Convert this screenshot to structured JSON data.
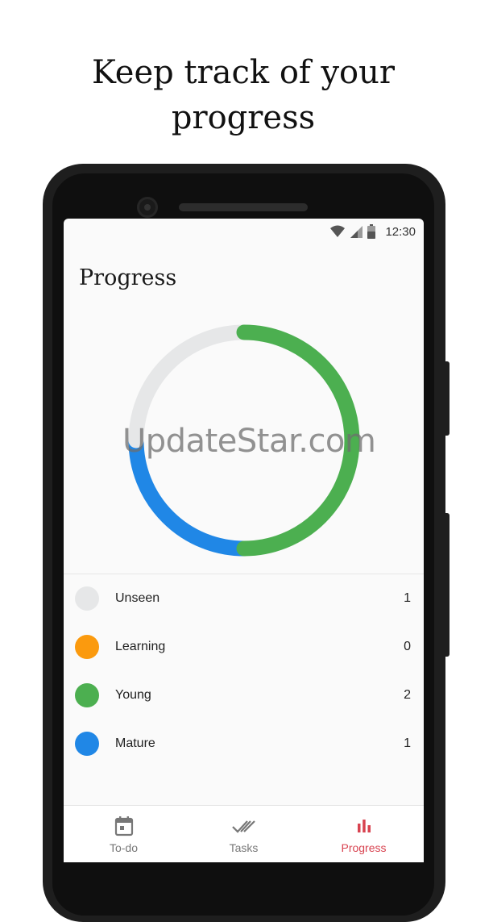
{
  "headline": {
    "line1": "Keep track of your",
    "line2": "progress"
  },
  "status_bar": {
    "time": "12:30",
    "icons": [
      "wifi-icon",
      "cell-signal-icon",
      "battery-icon"
    ]
  },
  "page": {
    "title": "Progress"
  },
  "donut": {
    "segments": [
      {
        "name": "Unseen",
        "value": 1,
        "color": "#e6e7e8"
      },
      {
        "name": "Learning",
        "value": 0,
        "color": "#fb9a0e"
      },
      {
        "name": "Young",
        "value": 2,
        "color": "#4caf50"
      },
      {
        "name": "Mature",
        "value": 1,
        "color": "#2087e6"
      }
    ]
  },
  "legend": [
    {
      "label": "Unseen",
      "count": "1",
      "color": "#e6e7e8"
    },
    {
      "label": "Learning",
      "count": "0",
      "color": "#fb9a0e"
    },
    {
      "label": "Young",
      "count": "2",
      "color": "#4caf50"
    },
    {
      "label": "Mature",
      "count": "1",
      "color": "#2087e6"
    }
  ],
  "watermark": "UpdateStar.com",
  "bottom_nav": {
    "items": [
      {
        "label": "To-do",
        "icon": "calendar-icon",
        "active": false
      },
      {
        "label": "Tasks",
        "icon": "double-check-icon",
        "active": false
      },
      {
        "label": "Progress",
        "icon": "bar-chart-icon",
        "active": true
      }
    ],
    "active_color": "#d84350",
    "inactive_color": "#777777"
  }
}
